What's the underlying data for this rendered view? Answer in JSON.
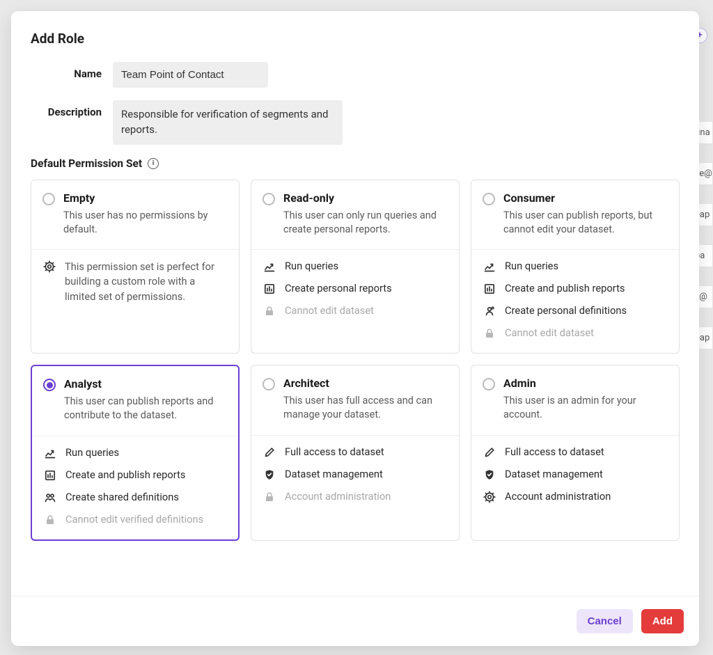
{
  "modal": {
    "title": "Add Role",
    "name_label": "Name",
    "name_value": "Team Point of Contact",
    "desc_label": "Description",
    "desc_value": "Responsible for verification of segments and reports.",
    "section_label": "Default Permission Set",
    "footer": {
      "cancel": "Cancel",
      "add": "Add"
    }
  },
  "permission_sets": [
    {
      "key": "empty",
      "title": "Empty",
      "desc": "This user has no permissions by default.",
      "selected": false,
      "note": {
        "icon": "gear-icon",
        "text": "This permission set is perfect for building a custom role with a limited set of permissions."
      },
      "perms": []
    },
    {
      "key": "read-only",
      "title": "Read-only",
      "desc": "This user can only run queries and create personal reports.",
      "selected": false,
      "perms": [
        {
          "icon": "chart-up-icon",
          "text": "Run queries",
          "muted": false
        },
        {
          "icon": "report-icon",
          "text": "Create personal reports",
          "muted": false
        },
        {
          "icon": "lock-icon",
          "text": "Cannot edit dataset",
          "muted": true
        }
      ]
    },
    {
      "key": "consumer",
      "title": "Consumer",
      "desc": "This user can publish reports, but cannot edit your dataset.",
      "selected": false,
      "perms": [
        {
          "icon": "chart-up-icon",
          "text": "Run queries",
          "muted": false
        },
        {
          "icon": "report-icon",
          "text": "Create and publish reports",
          "muted": false
        },
        {
          "icon": "definition-personal-icon",
          "text": "Create personal definitions",
          "muted": false
        },
        {
          "icon": "lock-icon",
          "text": "Cannot edit dataset",
          "muted": true
        }
      ]
    },
    {
      "key": "analyst",
      "title": "Analyst",
      "desc": "This user can publish reports and contribute to the dataset.",
      "selected": true,
      "perms": [
        {
          "icon": "chart-up-icon",
          "text": "Run queries",
          "muted": false
        },
        {
          "icon": "report-icon",
          "text": "Create and publish reports",
          "muted": false
        },
        {
          "icon": "definition-shared-icon",
          "text": "Create shared definitions",
          "muted": false
        },
        {
          "icon": "lock-icon",
          "text": "Cannot edit verified definitions",
          "muted": true
        }
      ]
    },
    {
      "key": "architect",
      "title": "Architect",
      "desc": "This user has full access and can manage your dataset.",
      "selected": false,
      "perms": [
        {
          "icon": "pencil-icon",
          "text": "Full access to dataset",
          "muted": false
        },
        {
          "icon": "shield-check-icon",
          "text": "Dataset management",
          "muted": false
        },
        {
          "icon": "lock-icon",
          "text": "Account administration",
          "muted": true
        }
      ]
    },
    {
      "key": "admin",
      "title": "Admin",
      "desc": "This user is an admin for your account.",
      "selected": false,
      "perms": [
        {
          "icon": "pencil-icon",
          "text": "Full access to dataset",
          "muted": false
        },
        {
          "icon": "shield-check-icon",
          "text": "Dataset management",
          "muted": false
        },
        {
          "icon": "gear-icon",
          "text": "Account administration",
          "muted": false
        }
      ]
    }
  ],
  "background_hints": {
    "badge": "+",
    "lines": [
      "tina",
      "ve@",
      "eap",
      "pa",
      "y@",
      "eap"
    ]
  }
}
